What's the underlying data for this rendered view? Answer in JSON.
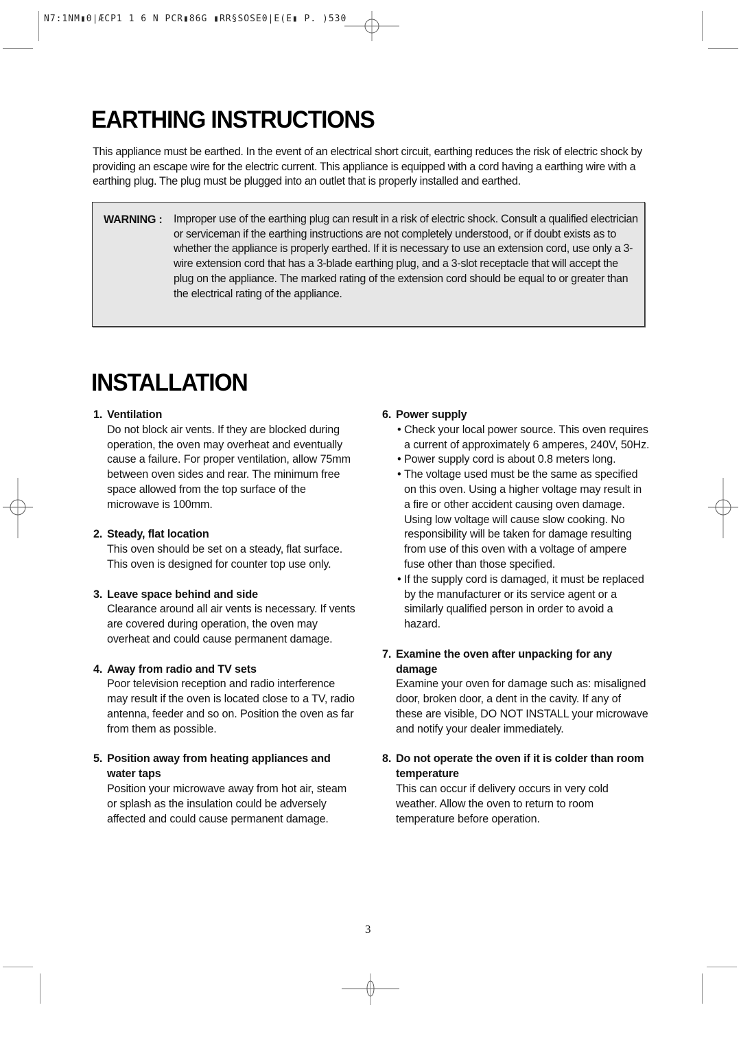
{
  "header": {
    "print_code": "N7:1NM▮0|ÆCP1 1 6 N PCR▮86G ▮RR§SOSE0|E(E▮ P. )530"
  },
  "earthing": {
    "title": "EARTHING INSTRUCTIONS",
    "intro": "This appliance must be earthed. In the event of an electrical short circuit, earthing reduces the risk of electric shock by providing an escape wire for the electric current. This appliance is equipped with a cord having a earthing wire with a earthing plug. The plug must be plugged into an outlet that is properly installed and earthed.",
    "warning": {
      "label": "WARNING :",
      "text": "Improper use of the earthing plug can result in a risk of electric shock. Consult a qualified electrician or serviceman if the earthing instructions are not completely understood, or if doubt exists as to whether the appliance is properly earthed. If it is necessary to use an extension cord, use only a 3-wire extension cord that has a 3-blade earthing plug, and a 3-slot receptacle that will accept the plug on the appliance. The marked rating of the extension cord should be equal to or greater than the electrical rating of the appliance."
    }
  },
  "installation": {
    "title": "INSTALLATION",
    "items": [
      {
        "number": "1.",
        "heading": "Ventilation",
        "body": [
          "Do not block air vents. If they are blocked during operation, the oven may overheat and eventually cause a failure. For proper ventilation, allow 75mm between oven sides and rear.  The minimum free space allowed from the top surface of the microwave is 100mm."
        ]
      },
      {
        "number": "2.",
        "heading": "Steady, flat location",
        "body": [
          "This oven should be set on a steady, flat surface.",
          "This oven is designed for counter top use only."
        ]
      },
      {
        "number": "3.",
        "heading": "Leave space behind and side",
        "body": [
          "Clearance around all air vents is necessary.  If vents are covered during operation, the oven may overheat and could cause permanent damage."
        ]
      },
      {
        "number": "4.",
        "heading": "Away from radio and TV sets",
        "body": [
          "Poor television reception and radio interference may result if the oven is located close to a TV, radio antenna, feeder and so on. Position the oven as far from them as possible."
        ]
      },
      {
        "number": "5.",
        "heading": "Position away from heating appliances and water taps",
        "body": [
          "Position your microwave away from hot air, steam or splash as the insulation could be adversely affected and could cause permanent damage."
        ]
      },
      {
        "number": "6.",
        "heading": "Power supply",
        "bullets": [
          "Check your local power source. This oven requires a current of approximately 6 amperes, 240V, 50Hz.",
          "Power supply cord is about 0.8 meters long.",
          "The voltage used must be the same as specified on this oven. Using a higher voltage may result in a fire or other accident causing oven damage. Using low voltage will cause slow cooking. No responsibility will be taken for damage resulting from use of this oven with a voltage of ampere fuse other than those specified.",
          "If the supply cord is damaged, it must be replaced by the manufacturer or its service agent or a similarly qualified person in order to avoid a hazard."
        ]
      },
      {
        "number": "7.",
        "heading": "Examine the oven after unpacking for any damage",
        "body": [
          "Examine your oven for damage such as: misaligned door, broken door, a dent in the cavity.  If any of these are visible, DO NOT INSTALL your microwave and notify your dealer immediately."
        ]
      },
      {
        "number": "8.",
        "heading": "Do not operate the oven if it is colder than room temperature",
        "body": [
          "This can occur if delivery occurs in very cold weather.  Allow the oven to return to room temperature before operation."
        ]
      }
    ]
  },
  "bullet_glyph": "•",
  "footer": {
    "page_number": "3"
  }
}
